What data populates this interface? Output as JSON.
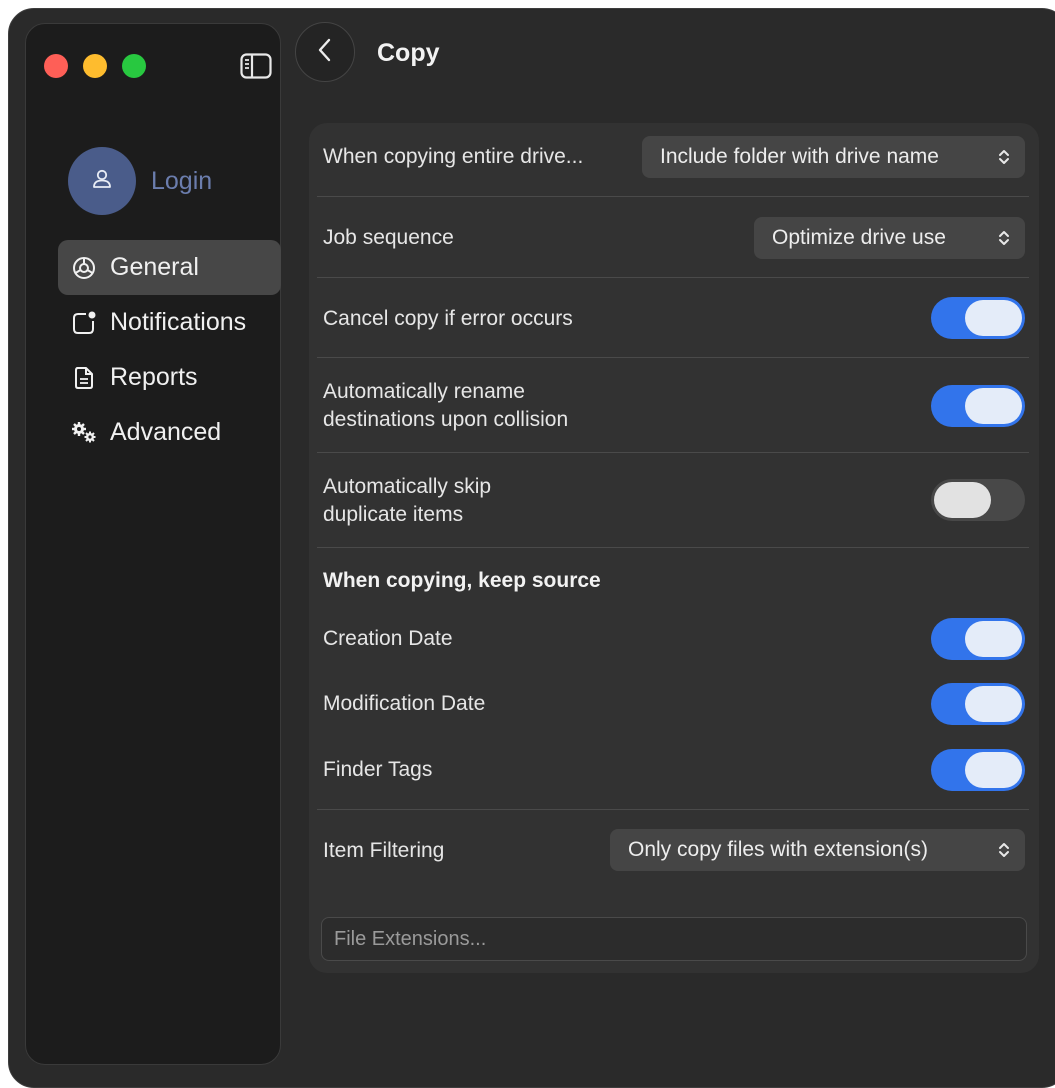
{
  "window": {
    "traffic_lights": [
      {
        "name": "close",
        "color": "#fe5f57"
      },
      {
        "name": "minimize",
        "color": "#febc2e"
      },
      {
        "name": "zoom",
        "color": "#28c840"
      }
    ]
  },
  "sidebar": {
    "toggle_icon": "sidebar-toggle-icon",
    "account": {
      "icon": "person-icon",
      "label": "Login"
    },
    "items": [
      {
        "label": "General",
        "icon": "gear-icon",
        "active": true
      },
      {
        "label": "Notifications",
        "icon": "notification-badge-icon",
        "active": false
      },
      {
        "label": "Reports",
        "icon": "document-icon",
        "active": false
      },
      {
        "label": "Advanced",
        "icon": "gears-icon",
        "active": false
      }
    ]
  },
  "header": {
    "back_icon": "chevron-left-icon",
    "title": "Copy"
  },
  "settings": {
    "drive_copy": {
      "label": "When copying entire drive...",
      "value": "Include folder with drive name"
    },
    "job_sequence": {
      "label": "Job sequence",
      "value": "Optimize drive use"
    },
    "cancel_on_error": {
      "label": "Cancel copy if error occurs",
      "on": true
    },
    "rename_collision": {
      "label_line1": "Automatically rename",
      "label_line2": "destinations upon collision",
      "on": true
    },
    "skip_duplicates": {
      "label_line1": "Automatically skip",
      "label_line2": "duplicate items",
      "on": false
    },
    "keep_source_heading": "When copying, keep source",
    "creation_date": {
      "label": "Creation Date",
      "on": true
    },
    "modification_date": {
      "label": "Modification Date",
      "on": true
    },
    "finder_tags": {
      "label": "Finder Tags",
      "on": true
    },
    "item_filtering": {
      "label": "Item Filtering",
      "value": "Only copy files with extension(s)"
    },
    "file_extensions": {
      "value": "",
      "placeholder": "File Extensions..."
    }
  },
  "colors": {
    "accent": "#3274eb",
    "window_bg": "#2a2a2a",
    "sidebar_bg": "#1c1c1c",
    "panel_bg": "#323232"
  }
}
